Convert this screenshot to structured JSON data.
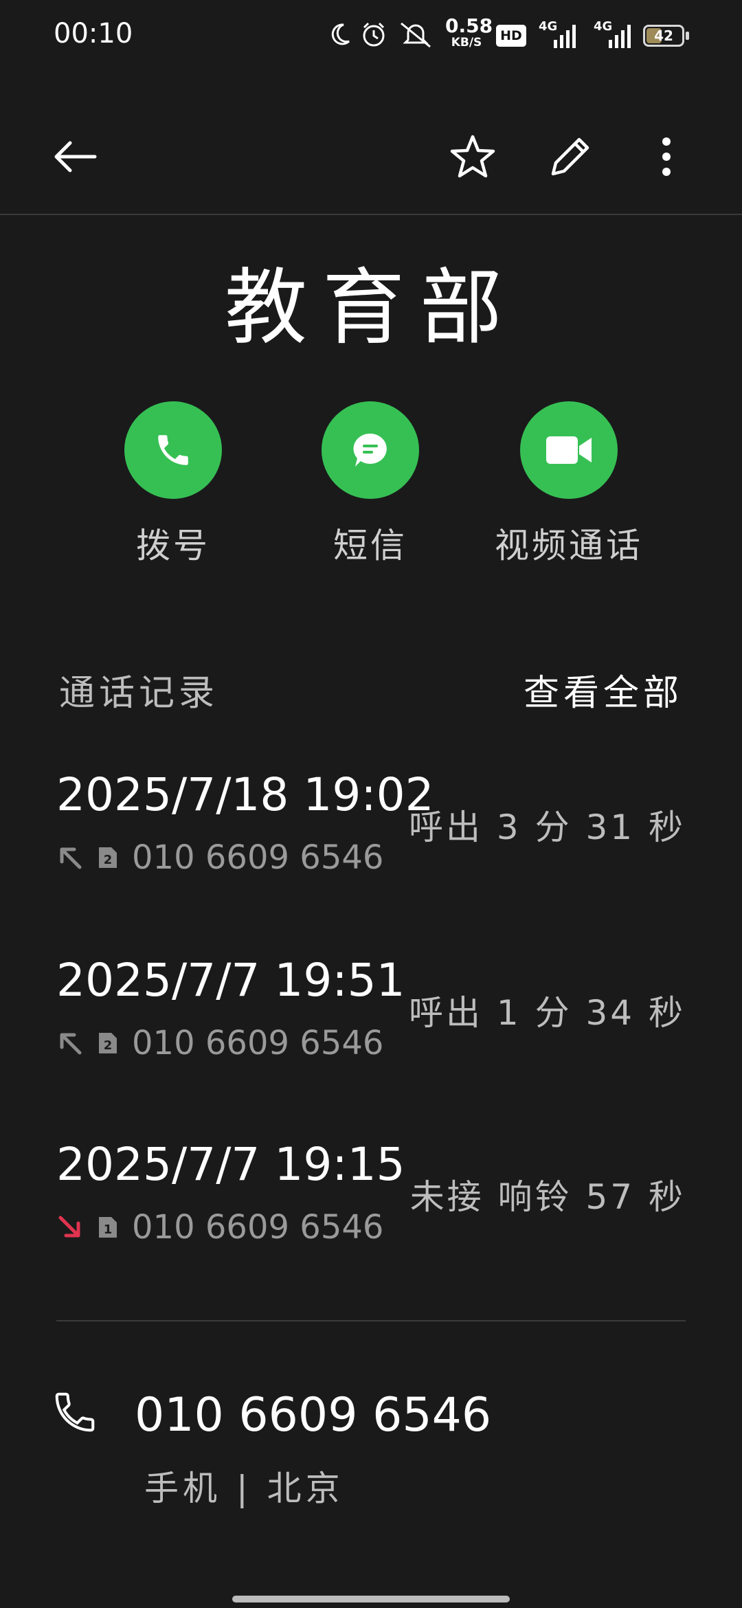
{
  "status_bar": {
    "time": "00:10",
    "net_speed_value": "0.58",
    "net_speed_unit": "KB/S",
    "hd_badge": "HD",
    "net_type_1": "4G",
    "net_type_2": "4G",
    "battery_level": "42",
    "battery_fraction": 0.42,
    "icons": [
      "moon-icon",
      "alarm-icon",
      "mute-icon",
      "signal-icon",
      "signal-icon"
    ]
  },
  "top_bar": {
    "icons": [
      "back-arrow-icon",
      "star-icon",
      "edit-icon",
      "more-vert-icon"
    ]
  },
  "contact": {
    "name": "教育部"
  },
  "actions": [
    {
      "label": "拨号",
      "icon": "phone-icon"
    },
    {
      "label": "短信",
      "icon": "message-icon"
    },
    {
      "label": "视频通话",
      "icon": "video-icon"
    }
  ],
  "call_history": {
    "title": "通话记录",
    "view_all": "查看全部",
    "calls": [
      {
        "datetime": "2025/7/18 19:02",
        "number": "010 6609 6546",
        "info": "呼出 3 分 31 秒",
        "direction": "outgoing",
        "sim": "2"
      },
      {
        "datetime": "2025/7/7 19:51",
        "number": "010 6609 6546",
        "info": "呼出 1 分 34 秒",
        "direction": "outgoing",
        "sim": "2"
      },
      {
        "datetime": "2025/7/7 19:15",
        "number": "010 6609 6546",
        "info": "未接 响铃 57 秒",
        "direction": "missed",
        "sim": "1"
      }
    ]
  },
  "number_section": {
    "number": "010 6609 6546",
    "meta": "手机 | 北京"
  },
  "colors": {
    "background": "#1a1a1b",
    "accent_green": "#36c054",
    "missed_red": "#e0344f",
    "secondary_text": "#bdbdbd"
  }
}
